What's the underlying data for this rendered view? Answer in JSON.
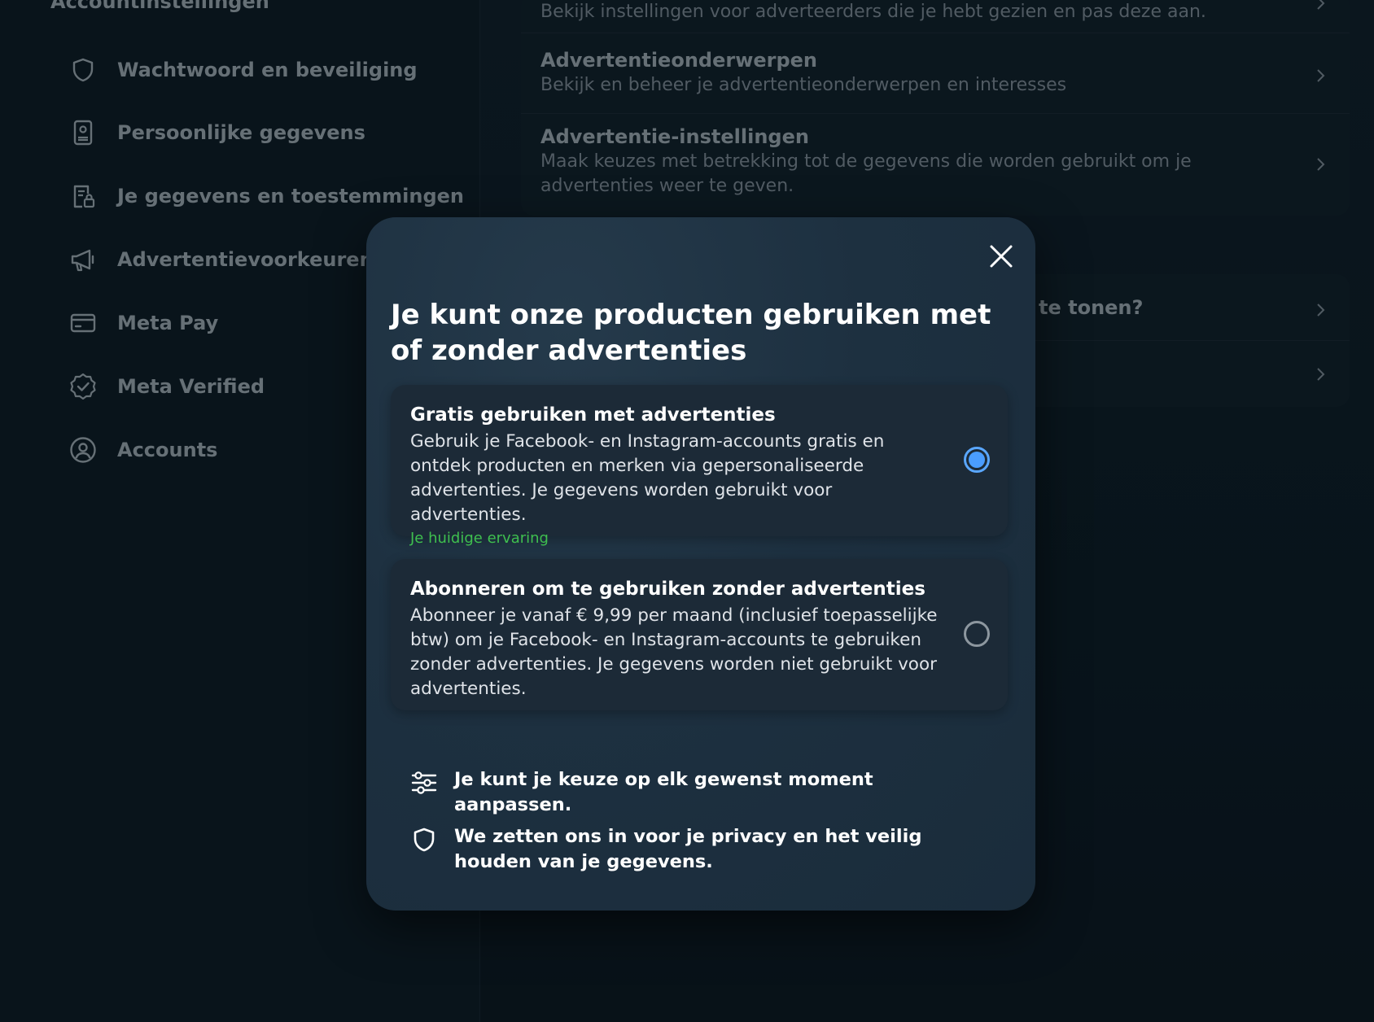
{
  "sidebar": {
    "heading": "Accountinstellingen",
    "items": [
      {
        "label": "Wachtwoord en beveiliging",
        "icon": "shield-icon"
      },
      {
        "label": "Persoonlijke gegevens",
        "icon": "id-card-icon"
      },
      {
        "label": "Je gegevens en toestemmingen",
        "icon": "document-lock-icon"
      },
      {
        "label": "Advertentievoorkeuren",
        "icon": "megaphone-icon"
      },
      {
        "label": "Meta Pay",
        "icon": "credit-card-icon"
      },
      {
        "label": "Meta Verified",
        "icon": "verified-badge-icon"
      },
      {
        "label": "Accounts",
        "icon": "user-circle-icon"
      }
    ]
  },
  "settings": {
    "rows": [
      {
        "title": "",
        "desc": "Bekijk instellingen voor adverteerders die je hebt gezien en pas deze aan."
      },
      {
        "title": "Advertentieonderwerpen",
        "desc": "Bekijk en beheer je advertentieonderwerpen en interesses"
      },
      {
        "title": "Advertentie-instellingen",
        "desc": "Maak keuzes met betrekking tot de gegevens die worden gebruikt om je advertenties weer te geven."
      }
    ],
    "partial_row_text": "te tonen?"
  },
  "modal": {
    "title": "Je kunt onze producten gebruiken met of zonder advertenties",
    "options": [
      {
        "title": "Gratis gebruiken met advertenties",
        "desc": "Gebruik je Facebook- en Instagram-accounts gratis en ontdek producten en merken via gepersonaliseerde advertenties. Je gegevens worden gebruikt voor advertenties.",
        "status": "Je huidige ervaring",
        "selected": true
      },
      {
        "title": "Abonneren om te gebruiken zonder advertenties",
        "desc": "Abonneer je vanaf € 9,99 per maand (inclusief toepasselijke btw) om je Facebook- en Instagram-accounts te gebruiken zonder advertenties. Je gegevens worden niet gebruikt voor advertenties.",
        "selected": false
      }
    ],
    "info": [
      {
        "text": "Je kunt je keuze op elk gewenst moment aanpassen.",
        "icon": "sliders-icon"
      },
      {
        "text": "We zetten ons in voor je privacy en het veilig houden van je gegevens.",
        "icon": "shield-icon"
      }
    ]
  },
  "colors": {
    "accent": "#4a9dff",
    "status_green": "#3fbf4f",
    "modal_bg": "#1d3040",
    "page_bg": "#0b141b"
  }
}
